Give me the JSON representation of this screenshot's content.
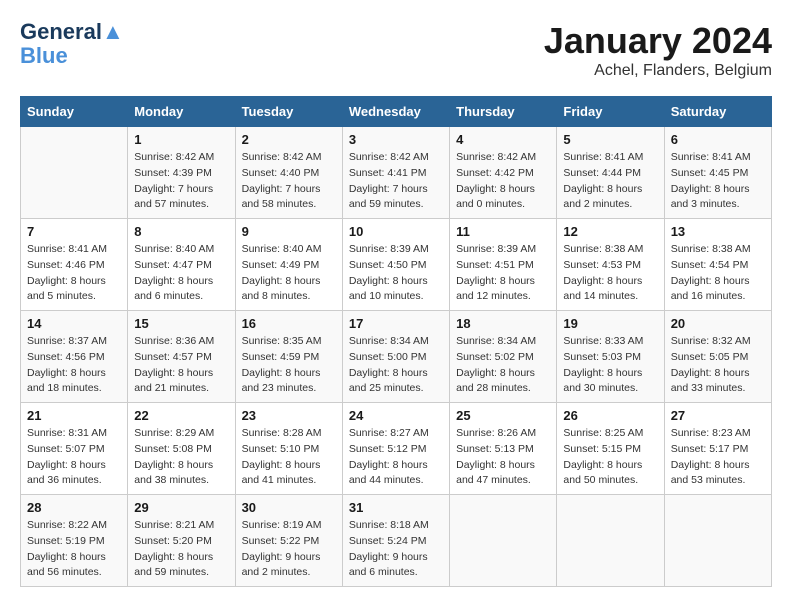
{
  "logo": {
    "line1": "General",
    "line2": "Blue"
  },
  "title": "January 2024",
  "subtitle": "Achel, Flanders, Belgium",
  "headers": [
    "Sunday",
    "Monday",
    "Tuesday",
    "Wednesday",
    "Thursday",
    "Friday",
    "Saturday"
  ],
  "weeks": [
    [
      {
        "day": "",
        "details": ""
      },
      {
        "day": "1",
        "details": "Sunrise: 8:42 AM\nSunset: 4:39 PM\nDaylight: 7 hours\nand 57 minutes."
      },
      {
        "day": "2",
        "details": "Sunrise: 8:42 AM\nSunset: 4:40 PM\nDaylight: 7 hours\nand 58 minutes."
      },
      {
        "day": "3",
        "details": "Sunrise: 8:42 AM\nSunset: 4:41 PM\nDaylight: 7 hours\nand 59 minutes."
      },
      {
        "day": "4",
        "details": "Sunrise: 8:42 AM\nSunset: 4:42 PM\nDaylight: 8 hours\nand 0 minutes."
      },
      {
        "day": "5",
        "details": "Sunrise: 8:41 AM\nSunset: 4:44 PM\nDaylight: 8 hours\nand 2 minutes."
      },
      {
        "day": "6",
        "details": "Sunrise: 8:41 AM\nSunset: 4:45 PM\nDaylight: 8 hours\nand 3 minutes."
      }
    ],
    [
      {
        "day": "7",
        "details": "Sunrise: 8:41 AM\nSunset: 4:46 PM\nDaylight: 8 hours\nand 5 minutes."
      },
      {
        "day": "8",
        "details": "Sunrise: 8:40 AM\nSunset: 4:47 PM\nDaylight: 8 hours\nand 6 minutes."
      },
      {
        "day": "9",
        "details": "Sunrise: 8:40 AM\nSunset: 4:49 PM\nDaylight: 8 hours\nand 8 minutes."
      },
      {
        "day": "10",
        "details": "Sunrise: 8:39 AM\nSunset: 4:50 PM\nDaylight: 8 hours\nand 10 minutes."
      },
      {
        "day": "11",
        "details": "Sunrise: 8:39 AM\nSunset: 4:51 PM\nDaylight: 8 hours\nand 12 minutes."
      },
      {
        "day": "12",
        "details": "Sunrise: 8:38 AM\nSunset: 4:53 PM\nDaylight: 8 hours\nand 14 minutes."
      },
      {
        "day": "13",
        "details": "Sunrise: 8:38 AM\nSunset: 4:54 PM\nDaylight: 8 hours\nand 16 minutes."
      }
    ],
    [
      {
        "day": "14",
        "details": "Sunrise: 8:37 AM\nSunset: 4:56 PM\nDaylight: 8 hours\nand 18 minutes."
      },
      {
        "day": "15",
        "details": "Sunrise: 8:36 AM\nSunset: 4:57 PM\nDaylight: 8 hours\nand 21 minutes."
      },
      {
        "day": "16",
        "details": "Sunrise: 8:35 AM\nSunset: 4:59 PM\nDaylight: 8 hours\nand 23 minutes."
      },
      {
        "day": "17",
        "details": "Sunrise: 8:34 AM\nSunset: 5:00 PM\nDaylight: 8 hours\nand 25 minutes."
      },
      {
        "day": "18",
        "details": "Sunrise: 8:34 AM\nSunset: 5:02 PM\nDaylight: 8 hours\nand 28 minutes."
      },
      {
        "day": "19",
        "details": "Sunrise: 8:33 AM\nSunset: 5:03 PM\nDaylight: 8 hours\nand 30 minutes."
      },
      {
        "day": "20",
        "details": "Sunrise: 8:32 AM\nSunset: 5:05 PM\nDaylight: 8 hours\nand 33 minutes."
      }
    ],
    [
      {
        "day": "21",
        "details": "Sunrise: 8:31 AM\nSunset: 5:07 PM\nDaylight: 8 hours\nand 36 minutes."
      },
      {
        "day": "22",
        "details": "Sunrise: 8:29 AM\nSunset: 5:08 PM\nDaylight: 8 hours\nand 38 minutes."
      },
      {
        "day": "23",
        "details": "Sunrise: 8:28 AM\nSunset: 5:10 PM\nDaylight: 8 hours\nand 41 minutes."
      },
      {
        "day": "24",
        "details": "Sunrise: 8:27 AM\nSunset: 5:12 PM\nDaylight: 8 hours\nand 44 minutes."
      },
      {
        "day": "25",
        "details": "Sunrise: 8:26 AM\nSunset: 5:13 PM\nDaylight: 8 hours\nand 47 minutes."
      },
      {
        "day": "26",
        "details": "Sunrise: 8:25 AM\nSunset: 5:15 PM\nDaylight: 8 hours\nand 50 minutes."
      },
      {
        "day": "27",
        "details": "Sunrise: 8:23 AM\nSunset: 5:17 PM\nDaylight: 8 hours\nand 53 minutes."
      }
    ],
    [
      {
        "day": "28",
        "details": "Sunrise: 8:22 AM\nSunset: 5:19 PM\nDaylight: 8 hours\nand 56 minutes."
      },
      {
        "day": "29",
        "details": "Sunrise: 8:21 AM\nSunset: 5:20 PM\nDaylight: 8 hours\nand 59 minutes."
      },
      {
        "day": "30",
        "details": "Sunrise: 8:19 AM\nSunset: 5:22 PM\nDaylight: 9 hours\nand 2 minutes."
      },
      {
        "day": "31",
        "details": "Sunrise: 8:18 AM\nSunset: 5:24 PM\nDaylight: 9 hours\nand 6 minutes."
      },
      {
        "day": "",
        "details": ""
      },
      {
        "day": "",
        "details": ""
      },
      {
        "day": "",
        "details": ""
      }
    ]
  ]
}
